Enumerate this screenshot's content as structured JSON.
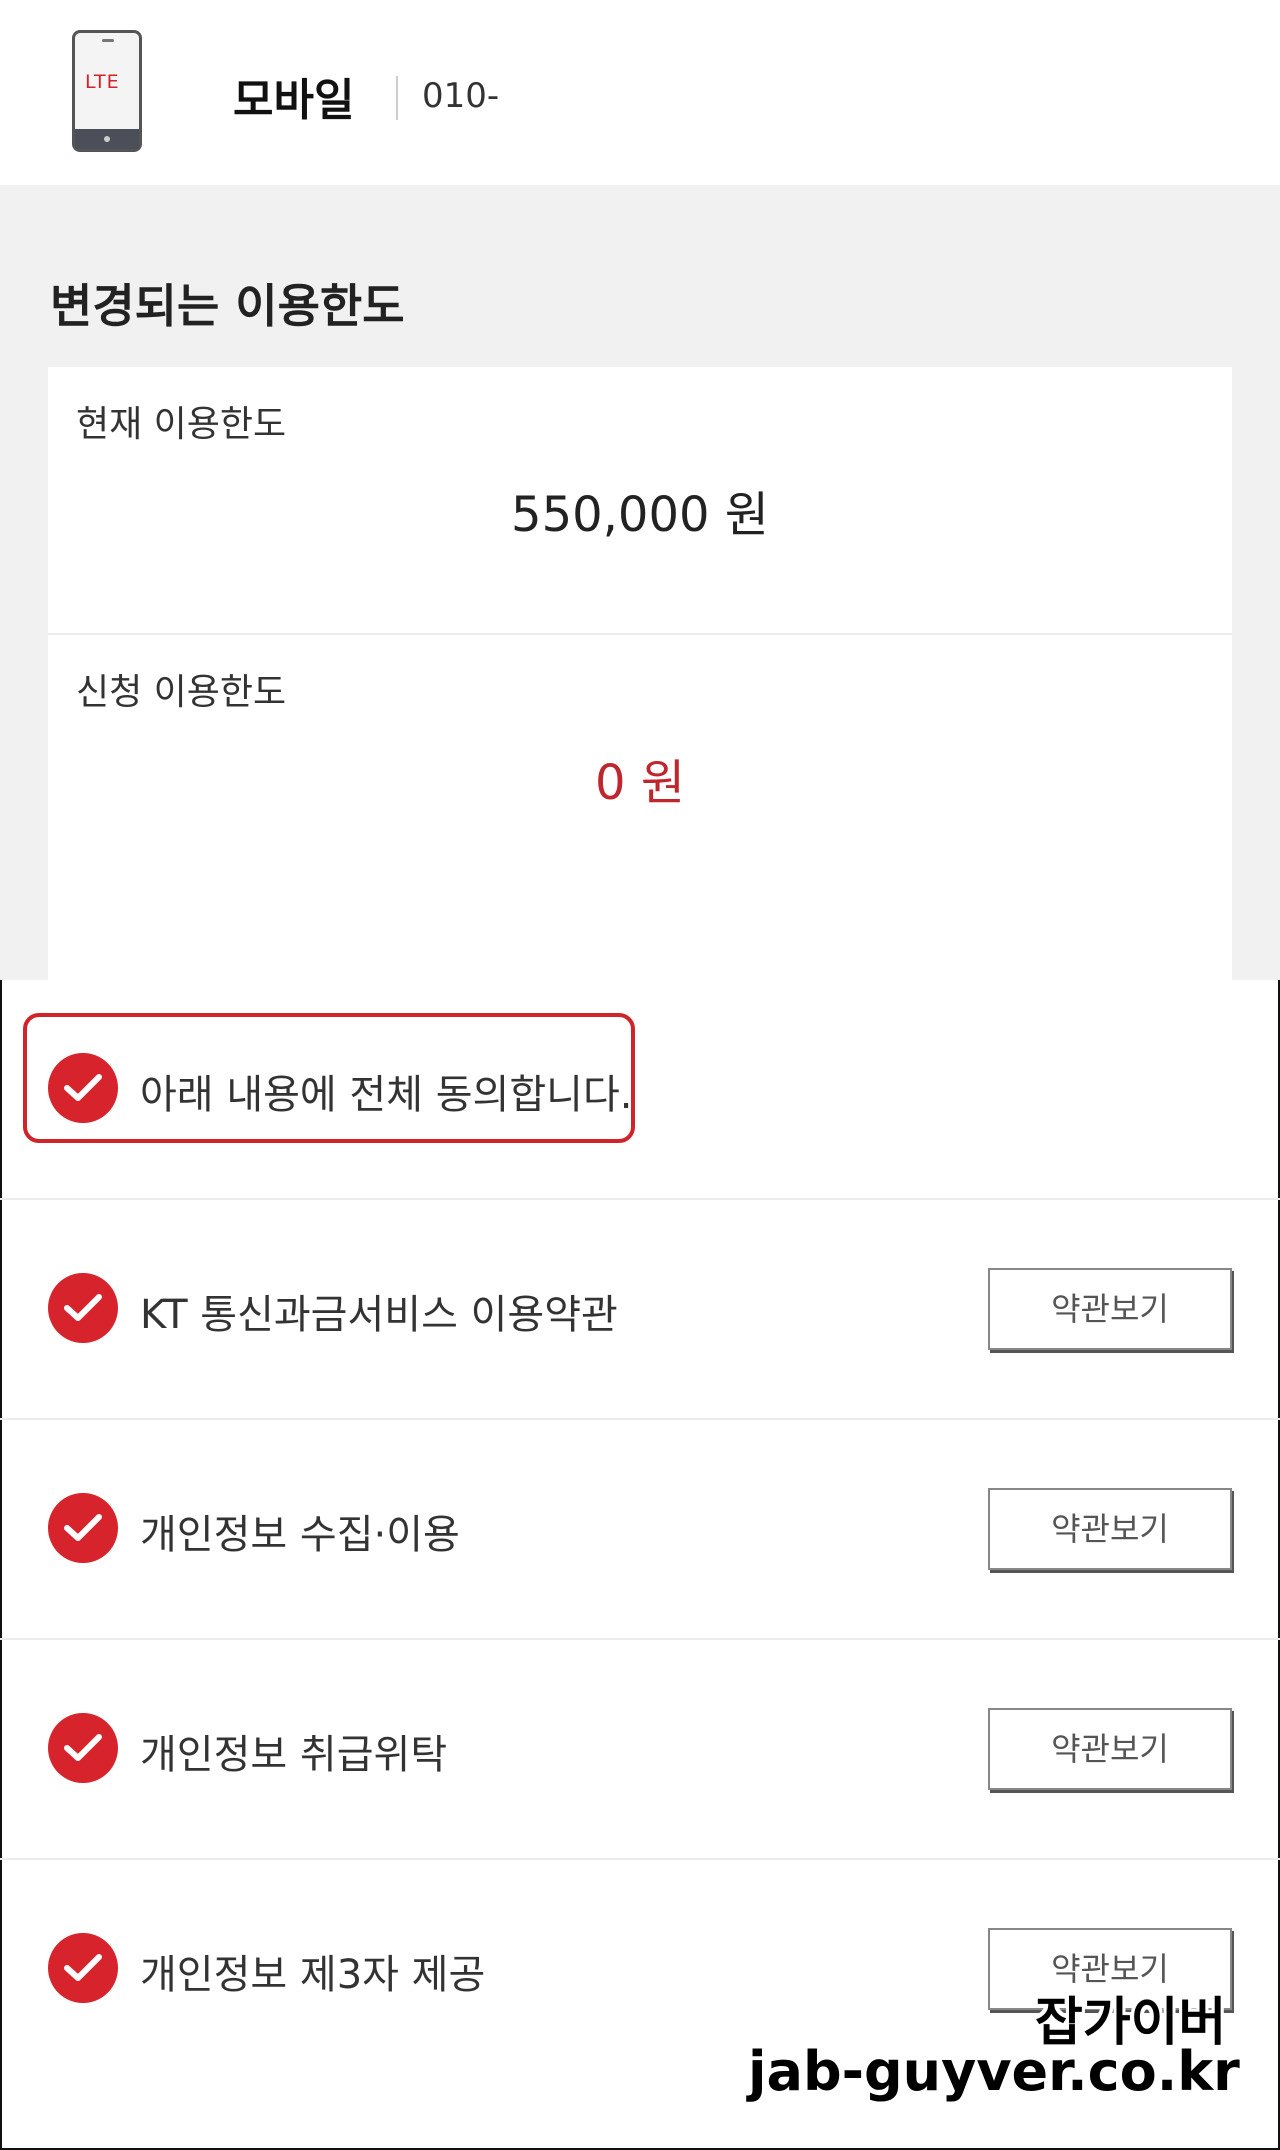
{
  "header": {
    "device_label": "LTE",
    "title": "모바일",
    "number": "010-"
  },
  "limit": {
    "section_title": "변경되는 이용한도",
    "current_label": "현재 이용한도",
    "current_value": "550,000 원",
    "requested_label": "신청 이용한도",
    "requested_value": "0 원"
  },
  "agreements": {
    "agree_all": "아래 내용에 전체 동의합니다.",
    "items": [
      {
        "label": "KT 통신과금서비스 이용약관",
        "button": "약관보기"
      },
      {
        "label": "개인정보 수집·이용",
        "button": "약관보기"
      },
      {
        "label": "개인정보 취급위탁",
        "button": "약관보기"
      },
      {
        "label": "개인정보 제3자 제공",
        "button": "약관보기"
      }
    ]
  },
  "watermark": {
    "name": "잡가이버",
    "url": "jab-guyver.co.kr"
  },
  "colors": {
    "accent_red": "#d7242c",
    "value_red": "#c0262d",
    "section_bg": "#f1f1f1"
  }
}
